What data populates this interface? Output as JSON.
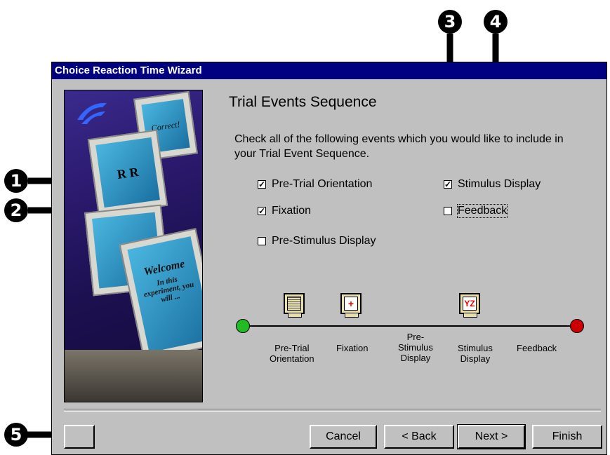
{
  "window": {
    "title": "Choice Reaction Time Wizard"
  },
  "art": {
    "screen1": "Correct!",
    "screen2": "R R",
    "screen3": "+",
    "screen4_title": "Welcome",
    "screen4_body": "In this experiment, you will ..."
  },
  "page": {
    "title": "Trial Events Sequence",
    "instructions": "Check all of the following events which you would like to include in your Trial Event Sequence."
  },
  "options": [
    {
      "label": "Pre-Trial Orientation",
      "checked": true
    },
    {
      "label": "Fixation",
      "checked": true
    },
    {
      "label": "Pre-Stimulus Display",
      "checked": false
    },
    {
      "label": "Stimulus Display",
      "checked": true
    },
    {
      "label": "Feedback",
      "checked": false
    }
  ],
  "timeline": {
    "icons": [
      "",
      "+",
      "YZ"
    ],
    "labels": [
      "Pre-Trial\nOrientation",
      "Fixation",
      "Pre-\nStimulus\nDisplay",
      "Stimulus\nDisplay",
      "Feedback"
    ],
    "start_color": "#22bb22",
    "end_color": "#cc0000"
  },
  "buttons": {
    "blank": "",
    "cancel": "Cancel",
    "back": "< Back",
    "next": "Next >",
    "finish": "Finish"
  },
  "callouts": [
    "1",
    "2",
    "3",
    "4",
    "5"
  ]
}
